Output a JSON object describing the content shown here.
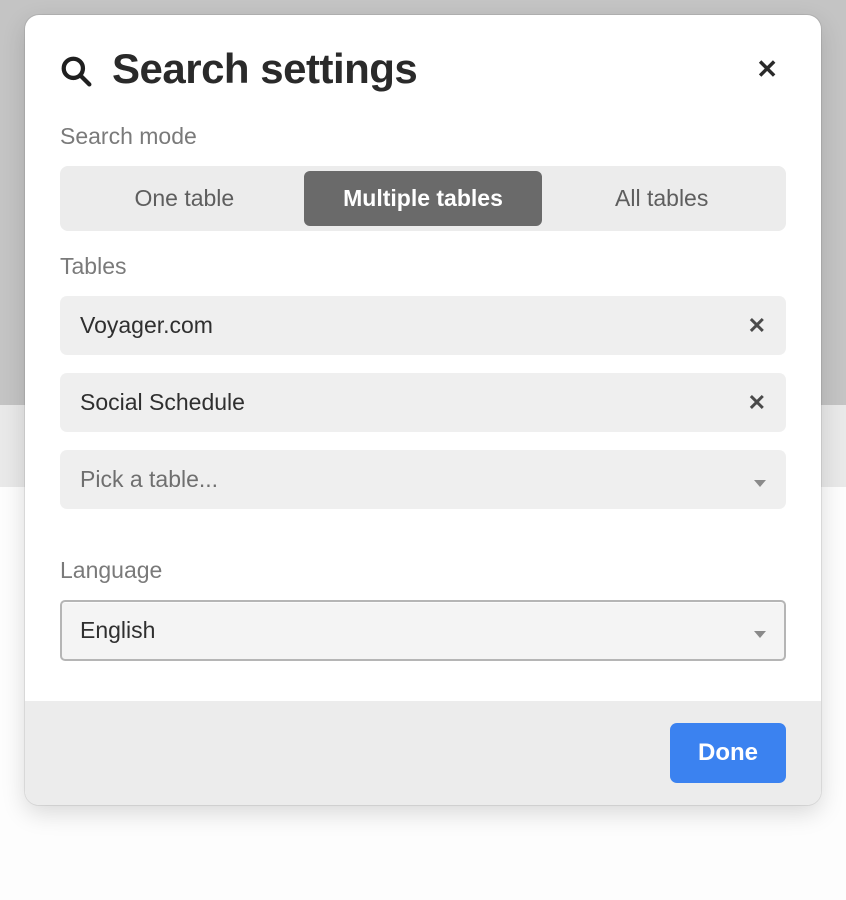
{
  "modal": {
    "title": "Search settings",
    "sections": {
      "search_mode": {
        "label": "Search mode",
        "options": {
          "one_table": "One table",
          "multiple_tables": "Multiple tables",
          "all_tables": "All tables"
        },
        "selected": "multiple_tables"
      },
      "tables": {
        "label": "Tables",
        "items": [
          {
            "name": "Voyager.com"
          },
          {
            "name": "Social Schedule"
          }
        ],
        "picker_placeholder": "Pick a table..."
      },
      "language": {
        "label": "Language",
        "selected": "English"
      }
    },
    "footer": {
      "done_label": "Done"
    }
  }
}
